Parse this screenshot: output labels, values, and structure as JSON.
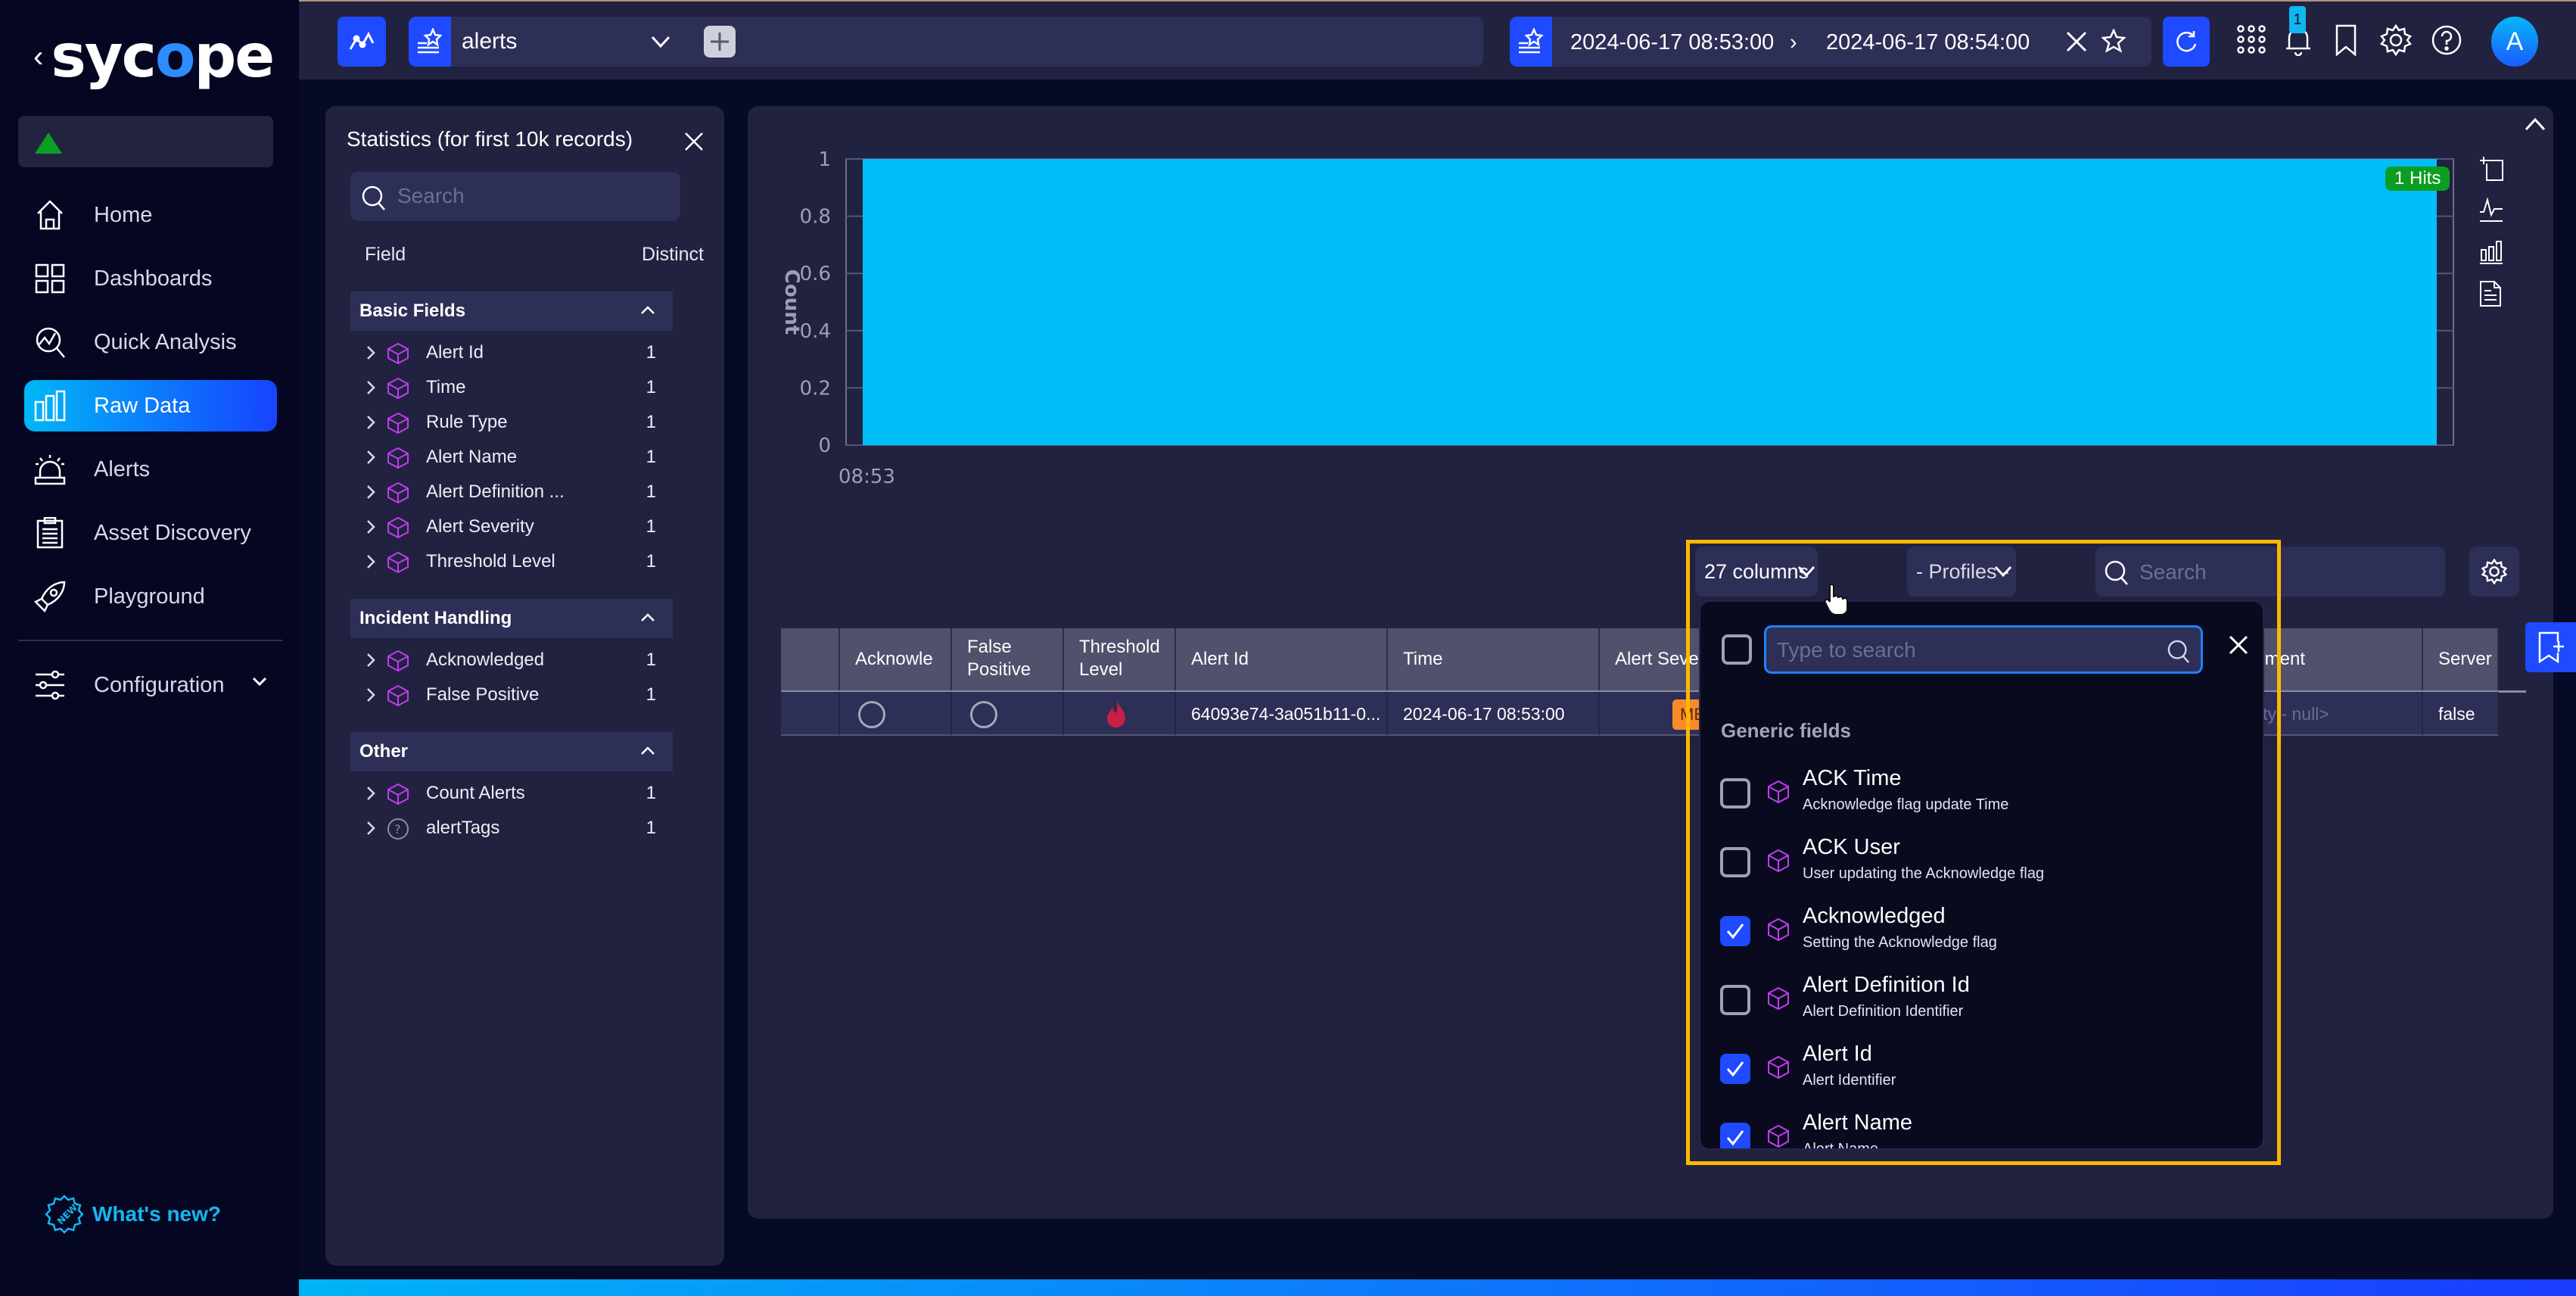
{
  "app": {
    "logo_text_before": "syc",
    "logo_text_o": "o",
    "logo_text_after": "pe",
    "back_glyph": "‹"
  },
  "sidebar": {
    "items": [
      {
        "label": "Home",
        "icon": "home-icon",
        "active": false
      },
      {
        "label": "Dashboards",
        "icon": "dashboards-icon",
        "active": false
      },
      {
        "label": "Quick Analysis",
        "icon": "quick-analysis-icon",
        "active": false
      },
      {
        "label": "Raw Data",
        "icon": "bar-chart-icon",
        "active": true
      },
      {
        "label": "Alerts",
        "icon": "siren-icon",
        "active": false
      },
      {
        "label": "Asset Discovery",
        "icon": "clipboard-icon",
        "active": false
      },
      {
        "label": "Playground",
        "icon": "rocket-icon",
        "active": false
      }
    ],
    "configuration": {
      "label": "Configuration",
      "icon": "sliders-icon"
    },
    "whats_new": "What's new?",
    "status_color": "#0b9f21"
  },
  "topbar": {
    "datasource": "alerts",
    "query_text": "",
    "time_from": "2024-06-17 08:53:00",
    "time_to": "2024-06-17 08:54:00",
    "time_separator": "›",
    "notification_count": "1",
    "avatar_initial": "A"
  },
  "stats_panel": {
    "title": "Statistics (for first 10k records)",
    "search_placeholder": "Search",
    "col_field": "Field",
    "col_distinct": "Distinct",
    "sections": [
      {
        "label": "Basic Fields",
        "fields": [
          {
            "name": "Alert Id",
            "distinct": "1",
            "type": "cube"
          },
          {
            "name": "Time",
            "distinct": "1",
            "type": "cube"
          },
          {
            "name": "Rule Type",
            "distinct": "1",
            "type": "cube"
          },
          {
            "name": "Alert Name",
            "distinct": "1",
            "type": "cube"
          },
          {
            "name": "Alert Definition ...",
            "distinct": "1",
            "type": "cube"
          },
          {
            "name": "Alert Severity",
            "distinct": "1",
            "type": "cube"
          },
          {
            "name": "Threshold Level",
            "distinct": "1",
            "type": "cube"
          }
        ]
      },
      {
        "label": "Incident Handling",
        "fields": [
          {
            "name": "Acknowledged",
            "distinct": "1",
            "type": "cube"
          },
          {
            "name": "False Positive",
            "distinct": "1",
            "type": "cube"
          }
        ]
      },
      {
        "label": "Other",
        "fields": [
          {
            "name": "Count Alerts",
            "distinct": "1",
            "type": "cube"
          },
          {
            "name": "alertTags",
            "distinct": "1",
            "type": "unknown"
          }
        ]
      }
    ]
  },
  "chart_data": {
    "type": "bar",
    "title": "",
    "xlabel": "",
    "ylabel": "Count",
    "categories": [
      "08:53"
    ],
    "values": [
      1
    ],
    "ylim": [
      0,
      1
    ],
    "yticks": [
      "0",
      "0.2",
      "0.4",
      "0.6",
      "0.8",
      "1"
    ],
    "xticks": [
      "08:53"
    ],
    "grid": true,
    "bar_color": "#00bef8",
    "hits_badge": "1 Hits",
    "hits_color": "#0a9e22"
  },
  "table_toolbar": {
    "columns_label": "27 columns",
    "profiles_label": "- Profiles -",
    "search_placeholder": "Search"
  },
  "table": {
    "columns": [
      "",
      "Acknowle",
      "False\nPositive",
      "Threshold\nLevel",
      "Alert Id",
      "Time",
      "Alert Seve",
      "Comment",
      "Server"
    ],
    "row": {
      "acknowledged": "",
      "false_positive": "",
      "threshold_icon": "flame-icon",
      "alert_id": "64093e74-3a051b11-0...",
      "time": "2024-06-17 08:53:00",
      "severity": "ME",
      "comment": "<empty - null>",
      "server": "false"
    },
    "severity_color": "#fb8a2b",
    "flame_color": "#c81f47"
  },
  "columns_dropdown": {
    "search_placeholder": "Type to search",
    "group": "Generic fields",
    "options": [
      {
        "name": "ACK Time",
        "desc": "Acknowledge flag update Time",
        "checked": false
      },
      {
        "name": "ACK User",
        "desc": "User updating the Acknowledge flag",
        "checked": false
      },
      {
        "name": "Acknowledged",
        "desc": "Setting the Acknowledge flag",
        "checked": true
      },
      {
        "name": "Alert Definition Id",
        "desc": "Alert Definition Identifier",
        "checked": false
      },
      {
        "name": "Alert Id",
        "desc": "Alert Identifier",
        "checked": true
      },
      {
        "name": "Alert Name",
        "desc": "Alert Name",
        "checked": true
      }
    ]
  }
}
